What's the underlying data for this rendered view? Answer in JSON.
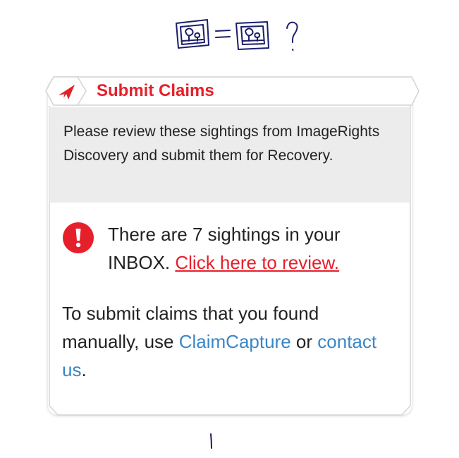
{
  "sketch": {
    "icons": [
      "picture-frame-icon",
      "equals-icon",
      "picture-frame-icon",
      "question-mark-icon"
    ],
    "ink_color": "#1b1e6b"
  },
  "card": {
    "title": "Submit Claims",
    "title_icon": "paper-plane-icon",
    "accent_color": "#e5202b",
    "intro_text": "Please review these sightings from ImageRights Discovery and submit them for Recovery.",
    "alert": {
      "icon": "exclamation-icon",
      "text_before": "There are 7 sightings in your INBOX.",
      "link_label": "Click here to review."
    },
    "manual": {
      "text_before": "To submit claims that you found manually, use",
      "claimcapture_label": "ClaimCapture",
      "text_middle": "or",
      "contact_label": "contact us",
      "text_after": "."
    },
    "link_color": "#3a86c6"
  }
}
